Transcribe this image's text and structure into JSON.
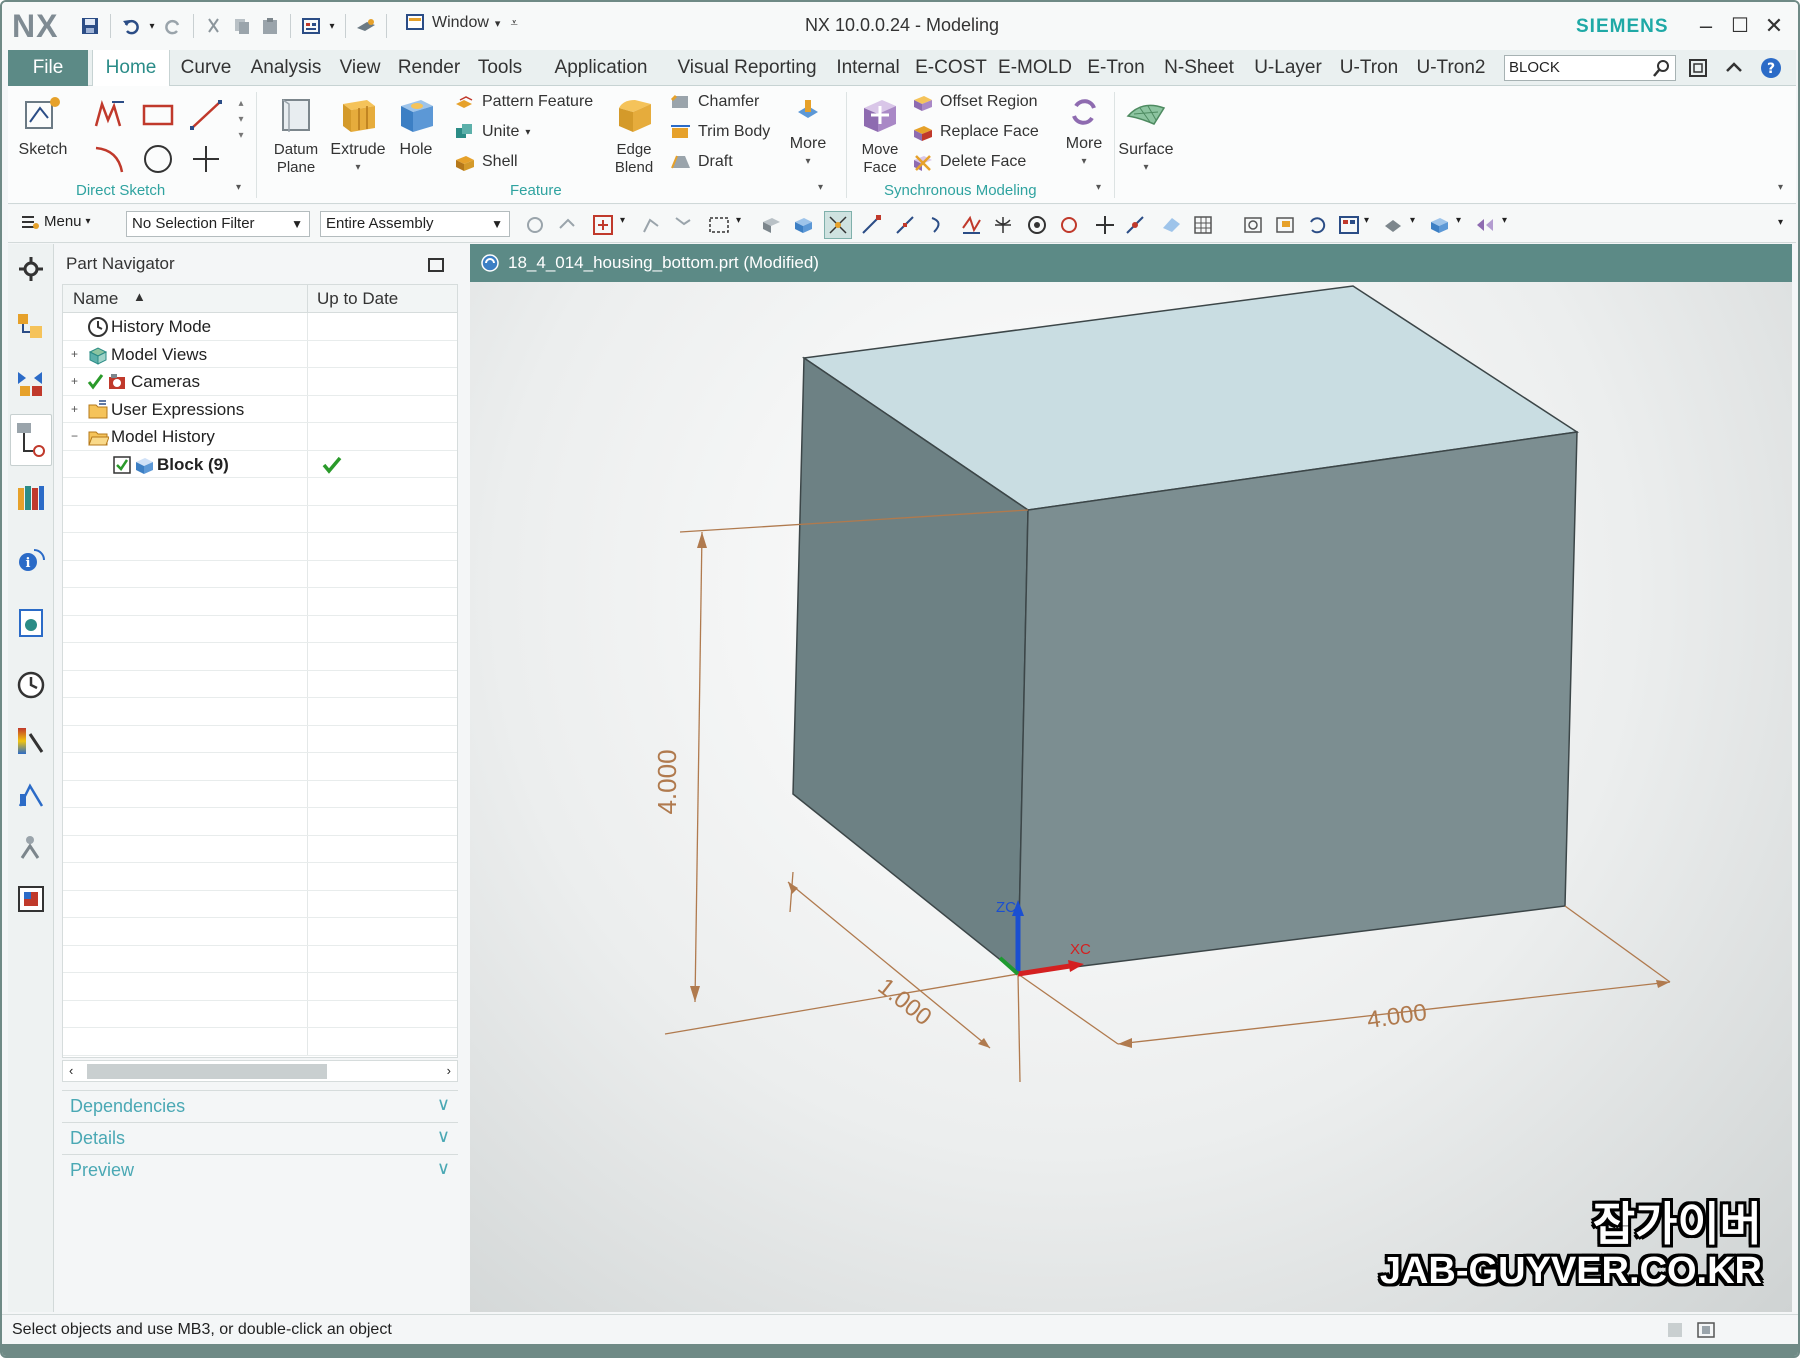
{
  "app": {
    "logo": "NX",
    "title": "NX 10.0.0.24 - Modeling",
    "brand": "SIEMENS",
    "window_menu": "Window"
  },
  "tabs": [
    "File",
    "Home",
    "Curve",
    "Analysis",
    "View",
    "Render",
    "Tools",
    "Application",
    "Visual Reporting",
    "Internal",
    "E-COST",
    "E-MOLD",
    "E-Tron",
    "N-Sheet",
    "U-Layer",
    "U-Tron",
    "U-Tron2"
  ],
  "search": {
    "value": "BLOCK"
  },
  "ribbon": {
    "direct_sketch": {
      "sketch": "Sketch",
      "group": "Direct Sketch"
    },
    "feature": {
      "datum_plane": "Datum\nPlane",
      "extrude": "Extrude",
      "hole": "Hole",
      "pattern_feature": "Pattern Feature",
      "unite": "Unite",
      "shell": "Shell",
      "edge_blend": "Edge\nBlend",
      "chamfer": "Chamfer",
      "trim_body": "Trim Body",
      "draft": "Draft",
      "more": "More",
      "group": "Feature"
    },
    "sync": {
      "move_face": "Move\nFace",
      "offset_region": "Offset Region",
      "replace_face": "Replace Face",
      "delete_face": "Delete Face",
      "more": "More",
      "group": "Synchronous Modeling"
    },
    "surface": {
      "surface": "Surface"
    }
  },
  "toolbar": {
    "menu": "Menu",
    "selection_filter": "No Selection Filter",
    "scope": "Entire Assembly"
  },
  "navigator": {
    "title": "Part Navigator",
    "col_name": "Name",
    "col_uptodate": "Up to Date",
    "rows": [
      {
        "label": "History Mode",
        "indent": 0
      },
      {
        "label": "Model Views",
        "indent": 0
      },
      {
        "label": "Cameras",
        "indent": 0
      },
      {
        "label": "User Expressions",
        "indent": 0
      },
      {
        "label": "Model History",
        "indent": 0
      },
      {
        "label": "Block (9)",
        "indent": 1,
        "uptodate": true
      }
    ],
    "panels": [
      "Dependencies",
      "Details",
      "Preview"
    ]
  },
  "graphics": {
    "file_title": "18_4_014_housing_bottom.prt (Modified)",
    "dims": {
      "height": "4.000",
      "depth": "1.000",
      "width": "4.000"
    },
    "axes": {
      "z": "ZC",
      "x": "XC"
    }
  },
  "status": "Select objects and use MB3, or double-click an object",
  "watermark": {
    "korean": "잡가이버",
    "site": "JAB-GUYVER.CO.KR"
  },
  "colors": {
    "accent": "#5c8a86",
    "teal_text": "#2fa3a0",
    "brand": "#1fa9a6",
    "top_face": "#c7dde2",
    "side_face": "#6f8386",
    "front_face": "#7d8e91",
    "dimension": "#b07a4e"
  }
}
